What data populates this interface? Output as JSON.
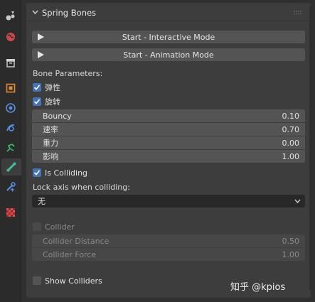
{
  "panel": {
    "title": "Spring Bones"
  },
  "buttons": {
    "interactive": "Start - Interactive Mode",
    "animation": "Start - Animation Mode"
  },
  "bone_parameters": {
    "heading": "Bone Parameters:",
    "checkboxes": [
      {
        "label": "弹性",
        "checked": true
      },
      {
        "label": "旋转",
        "checked": true
      }
    ],
    "fields": [
      {
        "label": "Bouncy",
        "value": "0.10"
      },
      {
        "label": "速率",
        "value": "0.70"
      },
      {
        "label": "重力",
        "value": "0.00"
      },
      {
        "label": "影响",
        "value": "1.00"
      }
    ],
    "is_colliding": {
      "label": "Is Colliding",
      "checked": true
    },
    "lock_axis_label": "Lock axis when colliding:",
    "lock_axis_value": "无"
  },
  "collider": {
    "checkbox": {
      "label": "Collider",
      "checked": false
    },
    "fields": [
      {
        "label": "Collider Distance",
        "value": "0.50"
      },
      {
        "label": "Collider Force",
        "value": "1.00"
      }
    ]
  },
  "show_colliders": {
    "label": "Show Colliders",
    "checked": false
  },
  "watermark": "知乎 @kpios",
  "colors": {
    "accent": "#4772b3",
    "panel_bg": "#3d3d3d",
    "field_bg": "#545454"
  }
}
